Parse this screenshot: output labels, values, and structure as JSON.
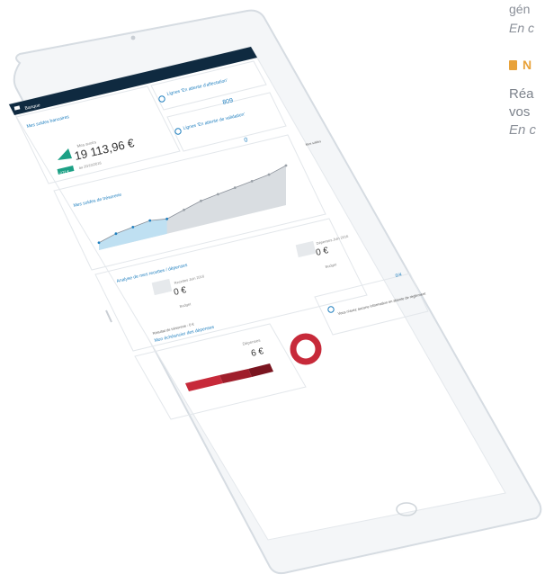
{
  "side_text": {
    "line1": "gén",
    "line2": "En c",
    "heading": "N",
    "p1": "Réa",
    "p2": "vos",
    "p3": "En c"
  },
  "app": {
    "brand": "Banque",
    "accent": "#1f7fbf",
    "header_color": "#0f2a40"
  },
  "widgets": {
    "accounts": {
      "title": "Mes soldes bancaires",
      "amount_label": "Mes avoirs",
      "amount": "19 113,96 €",
      "change": "-272 €",
      "date": "au 20/10/2016"
    },
    "uncat": {
      "title": "Lignes 'En attente d'affectation'",
      "value": "809"
    },
    "validate": {
      "title": "Lignes 'En attente de validation'",
      "value": "0"
    },
    "evolution": {
      "title": "Mes soldes de trésorerie",
      "legend": "Mes soldes"
    },
    "income": {
      "title": "Analyse de mes recettes / dépenses",
      "in_label": "Recettes Juin 2016",
      "in_value": "0 €",
      "out_label": "Dépenses Juin 2016",
      "out_value": "0 €",
      "budget": "Budget",
      "result": "Résultat de trésorerie : 0 €"
    },
    "expenses": {
      "title": "Mon échéancier des dépenses",
      "label": "Dépenses",
      "value": "6 €"
    },
    "alerts": {
      "title": "Vous n'avez aucune information en attente de règlement",
      "count": "0/4"
    }
  },
  "chart_data": {
    "type": "area",
    "series": [
      {
        "values": [
          3,
          5,
          6,
          7,
          6,
          8,
          10,
          11,
          12,
          13,
          14,
          16
        ]
      }
    ]
  }
}
